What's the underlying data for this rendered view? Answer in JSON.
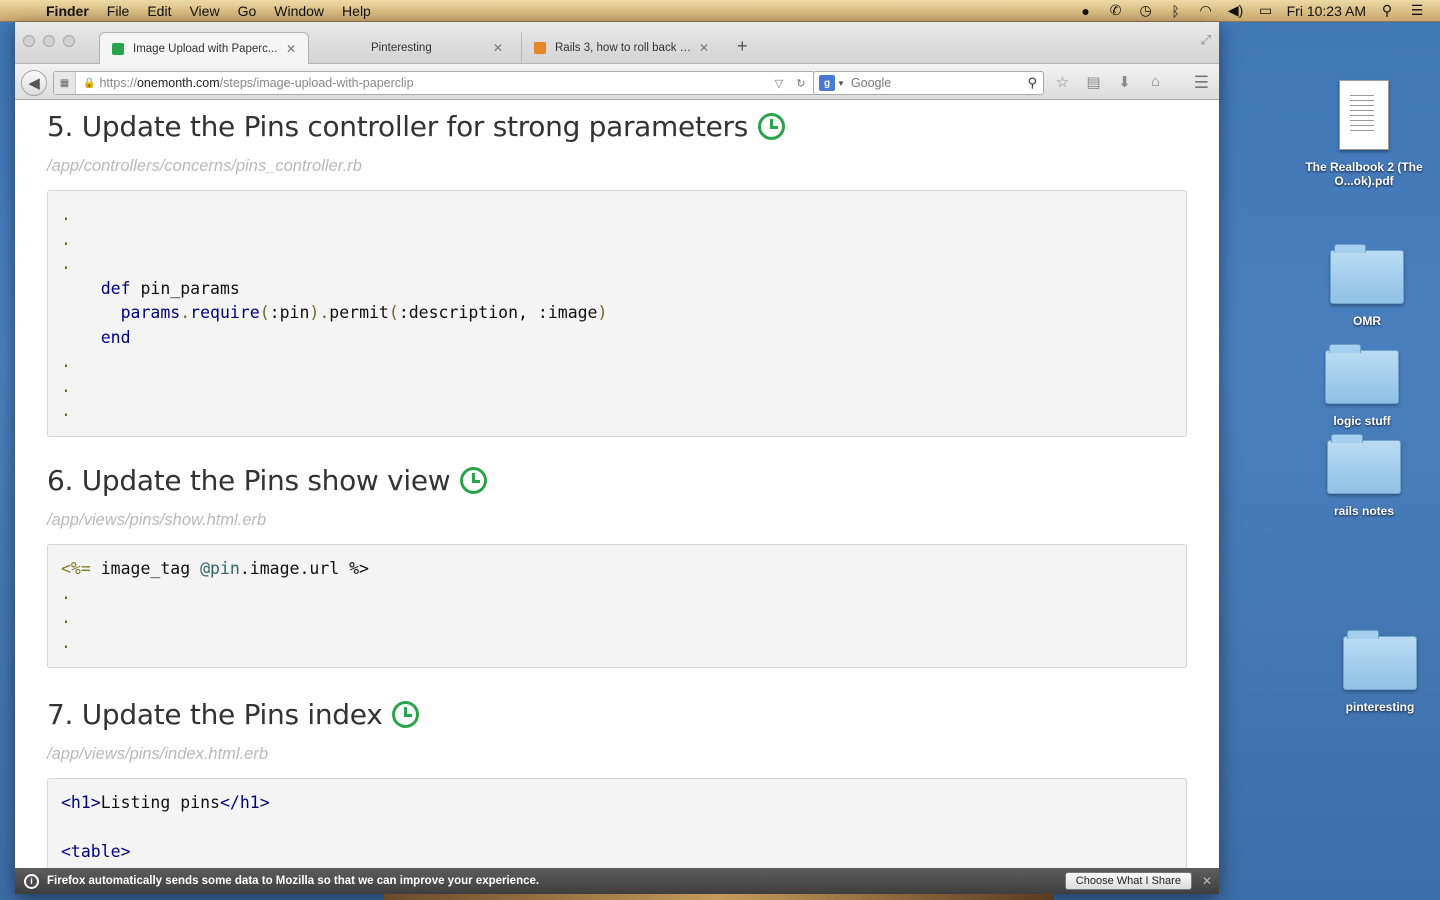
{
  "menubar": {
    "apple_glyph": "",
    "items": [
      "Finder",
      "File",
      "Edit",
      "View",
      "Go",
      "Window",
      "Help"
    ],
    "clock": "Fri 10:23 AM",
    "status_icons": [
      "skype-icon",
      "phone-icon",
      "time-machine-icon",
      "bluetooth-icon",
      "wifi-icon",
      "volume-icon",
      "battery-icon",
      "spotlight-icon",
      "notifications-icon"
    ]
  },
  "browser": {
    "tabs": [
      {
        "label": "Image Upload with Paperc...",
        "favicon_color": "#2aa34a"
      },
      {
        "label": "Pinteresting",
        "favicon_color": ""
      },
      {
        "label": "Rails 3, how to roll back a...",
        "favicon_color": "#e8862a"
      }
    ],
    "new_tab_label": "+",
    "url_prefix": "https://",
    "url_host": "onemonth.com",
    "url_path": "/steps/image-upload-with-paperclip",
    "search_placeholder": "Google",
    "search_engine_letter": "g"
  },
  "page": {
    "steps": [
      {
        "title": "5. Update the Pins controller for strong parameters",
        "path": "/app/controllers/concerns/pins_controller.rb"
      },
      {
        "title": "6. Update the Pins show view",
        "path": "/app/views/pins/show.html.erb"
      },
      {
        "title": "7. Update the Pins index",
        "path": "/app/views/pins/index.html.erb"
      }
    ],
    "code5": {
      "def_kw": "def",
      "method": " pin_params",
      "params_call": "params",
      "require": "require",
      "args1": ":pin",
      "permit": "permit",
      "args2": ":description, :image",
      "end_kw": "end"
    },
    "code6": {
      "erb_open": "<%=",
      "call": " image_tag ",
      "ivar": "@pin",
      "rest": ".image.url ",
      "erb_close": "%>"
    },
    "code7": {
      "h1_open": "<h1>",
      "h1_text": "Listing pins",
      "h1_close": "</h1>",
      "table_open": "<table>"
    }
  },
  "notification": {
    "message": "Firefox automatically sends some data to Mozilla so that we can improve your experience.",
    "button": "Choose What I Share"
  },
  "desktop": {
    "icons": [
      {
        "label": "The Realbook 2 (The O...ok).pdf",
        "kind": "pdf"
      },
      {
        "label": "OMR",
        "kind": "folder"
      },
      {
        "label": "logic stuff",
        "kind": "folder"
      },
      {
        "label": "rails notes",
        "kind": "folder"
      },
      {
        "label": "pinteresting",
        "kind": "folder"
      }
    ]
  }
}
